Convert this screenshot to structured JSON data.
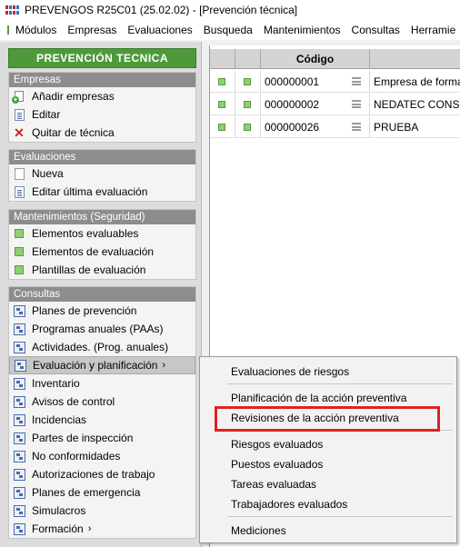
{
  "window": {
    "title": "PREVENGOS R25C01 (25.02.02) - [Prevención técnica]"
  },
  "menubar": [
    "Módulos",
    "Empresas",
    "Evaluaciones",
    "Busqueda",
    "Mantenimientos",
    "Consultas",
    "Herramie"
  ],
  "sidebar": {
    "header": "PREVENCIÓN TECNICA",
    "groups": [
      {
        "title": "Empresas",
        "items": [
          {
            "label": "Añadir empresas",
            "icon": "add-company-icon"
          },
          {
            "label": "Editar",
            "icon": "edit-document-icon"
          },
          {
            "label": "Quitar de técnica",
            "icon": "remove-icon"
          }
        ]
      },
      {
        "title": "Evaluaciones",
        "items": [
          {
            "label": "Nueva",
            "icon": "new-document-icon"
          },
          {
            "label": "Editar última evaluación",
            "icon": "edit-document-icon"
          }
        ]
      },
      {
        "title": "Mantenimientos (Seguridad)",
        "items": [
          {
            "label": "Elementos evaluables",
            "icon": "green-square-icon"
          },
          {
            "label": "Elementos de evaluación",
            "icon": "green-square-icon"
          },
          {
            "label": "Plantillas de evaluación",
            "icon": "green-square-icon"
          }
        ]
      },
      {
        "title": "Consultas",
        "items": [
          {
            "label": "Planes de prevención",
            "icon": "form-icon"
          },
          {
            "label": "Programas anuales (PAAs)",
            "icon": "form-icon"
          },
          {
            "label": "Actividades. (Prog. anuales)",
            "icon": "form-icon"
          },
          {
            "label": "Evaluación y planificación",
            "icon": "form-icon",
            "arrow": "›",
            "selected": true
          },
          {
            "label": "Inventario",
            "icon": "form-icon"
          },
          {
            "label": "Avisos de control",
            "icon": "form-icon"
          },
          {
            "label": "Incidencias",
            "icon": "form-icon"
          },
          {
            "label": "Partes de inspección",
            "icon": "form-icon"
          },
          {
            "label": "No conformidades",
            "icon": "form-icon"
          },
          {
            "label": "Autorizaciones de trabajo",
            "icon": "form-icon"
          },
          {
            "label": "Planes de emergencia",
            "icon": "form-icon"
          },
          {
            "label": "Simulacros",
            "icon": "form-icon"
          },
          {
            "label": "Formación",
            "icon": "form-icon",
            "arrow": "›"
          }
        ]
      }
    ]
  },
  "grid": {
    "columns": [
      "",
      "",
      "Código",
      ""
    ],
    "rows": [
      {
        "code": "000000001",
        "name": "Empresa de formacio"
      },
      {
        "code": "000000002",
        "name": "NEDATEC CONSULT"
      },
      {
        "code": "000000026",
        "name": "PRUEBA"
      }
    ]
  },
  "submenu": {
    "items": [
      "Evaluaciones de riesgos",
      "Planificación de la acción preventiva",
      "Revisiones de la acción preventiva",
      "Riesgos evaluados",
      "Puestos evaluados",
      "Tareas evaluadas",
      "Trabajadores evaluados",
      "Mediciones"
    ],
    "highlighted": "Revisiones de la acción preventiva"
  },
  "colors": {
    "header_green": "#4e9a3a",
    "group_title_gray": "#8d8d8d",
    "highlight_red": "#e02020"
  }
}
